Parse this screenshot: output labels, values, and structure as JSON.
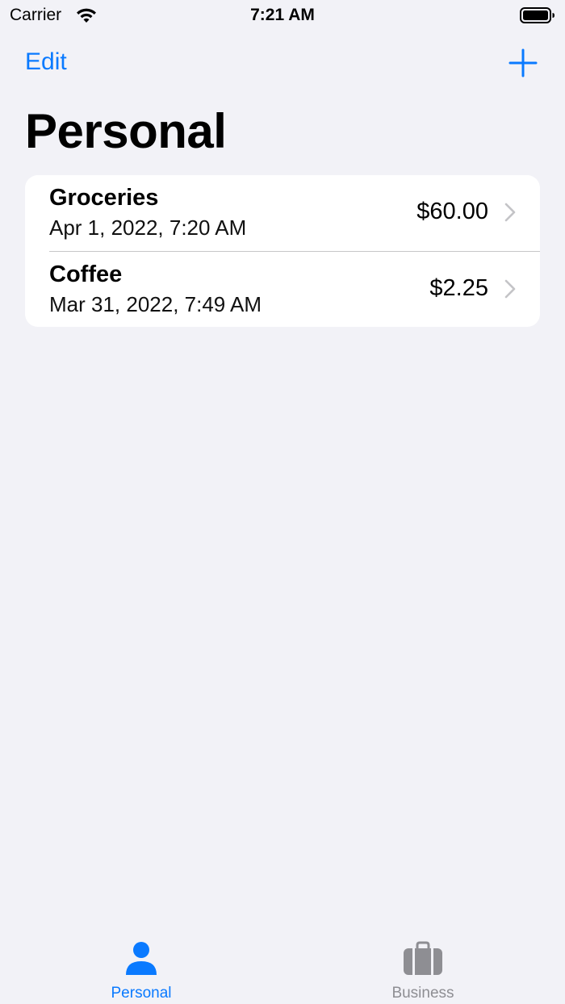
{
  "status_bar": {
    "carrier": "Carrier",
    "time": "7:21 AM"
  },
  "nav": {
    "edit_label": "Edit",
    "add_icon": "plus-icon",
    "title": "Personal"
  },
  "expenses": [
    {
      "title": "Groceries",
      "date": "Apr 1, 2022, 7:20 AM",
      "amount": "$60.00"
    },
    {
      "title": "Coffee",
      "date": "Mar 31, 2022, 7:49 AM",
      "amount": "$2.25"
    }
  ],
  "tab_bar": {
    "tabs": [
      {
        "label": "Personal",
        "icon": "person-icon",
        "selected": true
      },
      {
        "label": "Business",
        "icon": "briefcase-icon",
        "selected": false
      }
    ]
  },
  "colors": {
    "accent": "#0a7aff",
    "background": "#f2f2f7",
    "inactive": "#8e8e93"
  }
}
